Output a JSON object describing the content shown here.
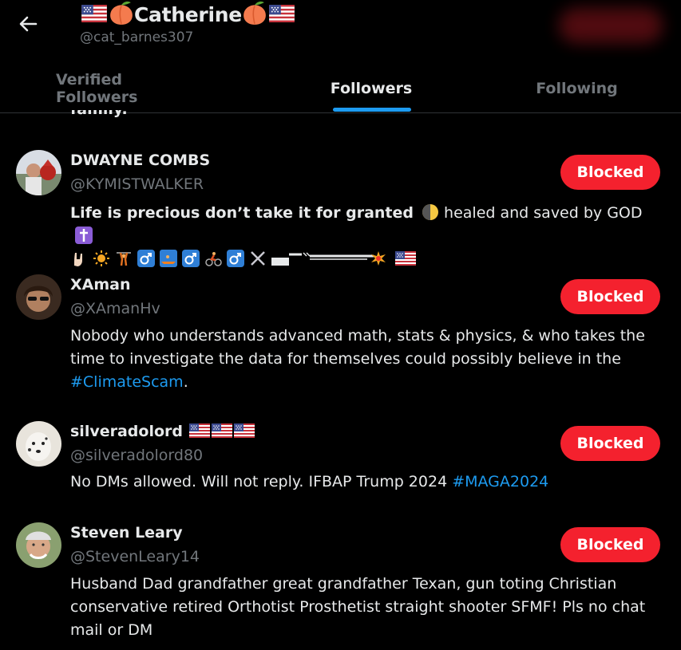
{
  "profile": {
    "name": "Catherine",
    "handle": "@cat_barnes307"
  },
  "tabs": [
    {
      "label": "Verified Followers",
      "active": false
    },
    {
      "label": "Followers",
      "active": true
    },
    {
      "label": "Following",
      "active": false
    }
  ],
  "cut_off_text": "family.",
  "users": [
    {
      "name": "DWAYNE COMBS",
      "handle": "@KYMISTWALKER",
      "bio_bold": "Life is precious don’t take it for granted",
      "bio_rest": "healed and saved by GOD",
      "button": "Blocked"
    },
    {
      "name": "XAman",
      "handle": "@XAmanHv",
      "bio_text": "Nobody who understands advanced math, stats & physics, & who takes the time to investigate the data for themselves could possibly believe in the ",
      "bio_hashtag": "#ClimateScam",
      "bio_end": ".",
      "button": "Blocked"
    },
    {
      "name": "silveradolord",
      "handle": "@silveradolord80",
      "bio_text": "No DMs allowed. Will not reply. IFBAP Trump 2024 ",
      "bio_hashtag": "#MAGA2024",
      "button": "Blocked"
    },
    {
      "name": "Steven Leary",
      "handle": "@StevenLeary14",
      "bio_text": "Husband Dad grandfather great grandfather Texan, gun toting Christian conservative retired Orthotist Prosthetist straight shooter SFMF! Pls no chat mail or DM",
      "button": "Blocked"
    }
  ],
  "colors": {
    "background": "#000000",
    "accent": "#1d9bf0",
    "blocked": "#f4212e",
    "muted": "#71767b"
  }
}
